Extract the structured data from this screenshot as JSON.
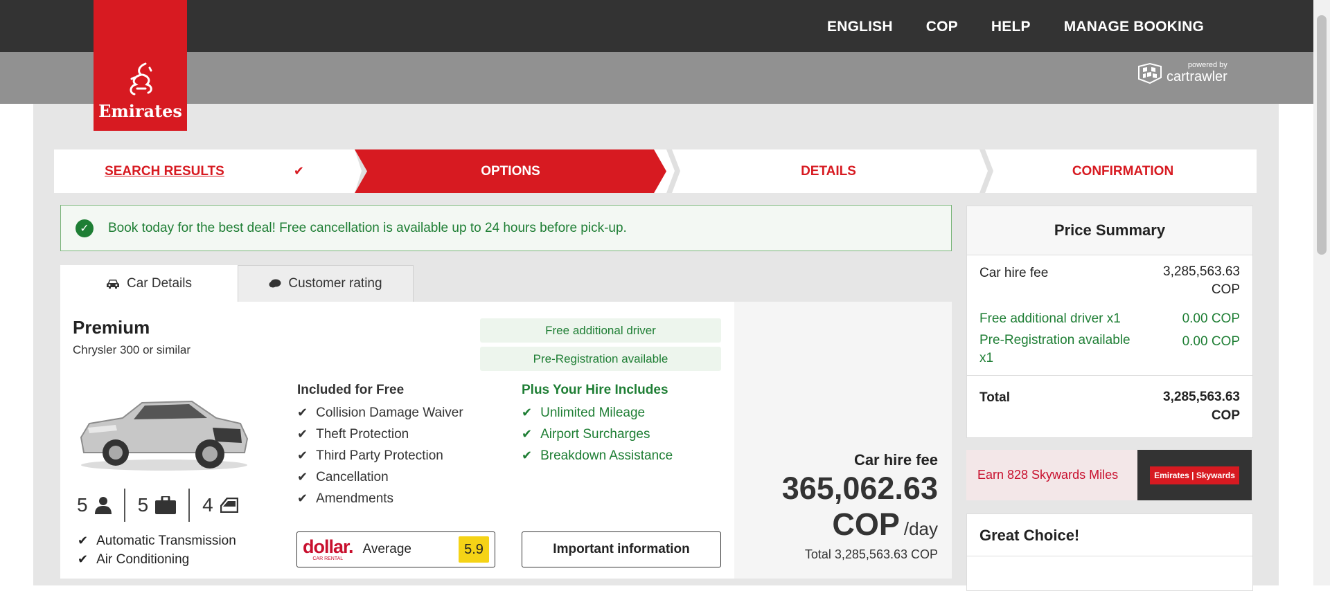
{
  "nav": {
    "items": [
      "ENGLISH",
      "COP",
      "HELP",
      "MANAGE BOOKING"
    ]
  },
  "logo": {
    "brand": "Emirates"
  },
  "powered": {
    "line1": "powered by",
    "line2": "cartrawler"
  },
  "steps": [
    {
      "label": "SEARCH RESULTS",
      "state": "done"
    },
    {
      "label": "OPTIONS",
      "state": "active"
    },
    {
      "label": "DETAILS",
      "state": "pending"
    },
    {
      "label": "CONFIRMATION",
      "state": "pending"
    }
  ],
  "notice": {
    "text": "Book today for the best deal! Free cancellation is available up to 24 hours before pick-up."
  },
  "tabs": [
    {
      "label": "Car Details",
      "icon": "car-icon"
    },
    {
      "label": "Customer rating",
      "icon": "speech-bubble-icon"
    }
  ],
  "car": {
    "category": "Premium",
    "model": "Chrysler 300 or similar",
    "badges": [
      "Free additional driver",
      "Pre-Registration available"
    ],
    "specs": {
      "seats": "5",
      "bags": "5",
      "doors": "4"
    },
    "features": [
      "Automatic Transmission",
      "Air Conditioning"
    ],
    "included_title": "Included for Free",
    "included": [
      "Collision Damage Waiver",
      "Theft Protection",
      "Third Party Protection",
      "Cancellation",
      "Amendments"
    ],
    "hire_title": "Plus Your Hire Includes",
    "hire": [
      "Unlimited Mileage",
      "Airport Surcharges",
      "Breakdown Assistance"
    ],
    "supplier": "dollar.",
    "supplier_sub": "CAR RENTAL",
    "rating_label": "Average",
    "rating_score": "5.9",
    "info_button": "Important information"
  },
  "price": {
    "label": "Car hire fee",
    "amount": "365,062.63",
    "currency": "COP",
    "per": "/day",
    "total": "Total 3,285,563.63 COP"
  },
  "summary": {
    "title": "Price Summary",
    "rows": [
      {
        "label": "Car hire fee",
        "value1": "3,285,563.63",
        "value2": "COP"
      },
      {
        "label": "Free additional driver x1",
        "value": "0.00 COP"
      },
      {
        "label1": "Pre-Registration available",
        "label2": "x1",
        "value": "0.00 COP"
      }
    ],
    "total_label": "Total",
    "total_value1": "3,285,563.63",
    "total_value2": "COP"
  },
  "miles": {
    "text": "Earn 828 Skywards Miles",
    "logo": "Emirates | Skywards"
  },
  "choice": {
    "title": "Great Choice!"
  },
  "colors": {
    "brand_red": "#d71a21",
    "success_green": "#1e7e34",
    "dark_bar": "#333333",
    "rating_yellow": "#f5d316"
  }
}
